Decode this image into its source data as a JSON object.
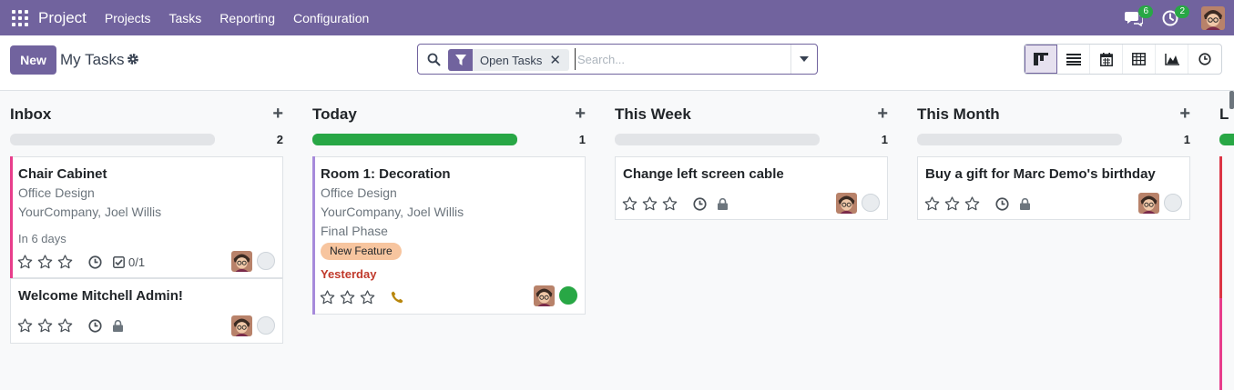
{
  "nav": {
    "app_title": "Project",
    "menu": [
      "Projects",
      "Tasks",
      "Reporting",
      "Configuration"
    ],
    "messages_count": "6",
    "activities_count": "2"
  },
  "control": {
    "new_label": "New",
    "breadcrumb": "My Tasks",
    "facet_label": "Open Tasks",
    "search_placeholder": "Search..."
  },
  "views": [
    "kanban-icon",
    "list-icon",
    "calendar-icon",
    "pivot-icon",
    "graph-icon",
    "activity-icon"
  ],
  "columns": [
    {
      "title": "Inbox",
      "count": "2",
      "progress": 0,
      "cards": [
        {
          "title": "Chair Cabinet",
          "project": "Office Design",
          "customer": "YourCompany, Joel Willis",
          "deadline": "In 6 days",
          "subtasks": "0/1",
          "color": "#e83e8c",
          "state": "normal"
        },
        {
          "title": "Welcome Mitchell Admin!",
          "color": "",
          "state": "normal"
        }
      ]
    },
    {
      "title": "Today",
      "count": "1",
      "progress": 1.0,
      "cards": [
        {
          "title": "Room 1: Decoration",
          "project": "Office Design",
          "customer": "YourCompany, Joel Willis",
          "stage": "Final Phase",
          "tag": "New Feature",
          "deadline": "Yesterday",
          "color": "#a78bdb",
          "state": "done"
        }
      ]
    },
    {
      "title": "This Week",
      "count": "1",
      "progress": 0,
      "cards": [
        {
          "title": "Change left screen cable",
          "state": "normal"
        }
      ]
    },
    {
      "title": "This Month",
      "count": "1",
      "progress": 0,
      "cards": [
        {
          "title": "Buy a gift for Marc Demo's birthday",
          "state": "normal"
        }
      ]
    },
    {
      "title": "L"
    }
  ],
  "colors": {
    "brand": "#71639e",
    "done": "#28a745",
    "overdue": "#c0392b",
    "tag": "#f7c59f"
  }
}
